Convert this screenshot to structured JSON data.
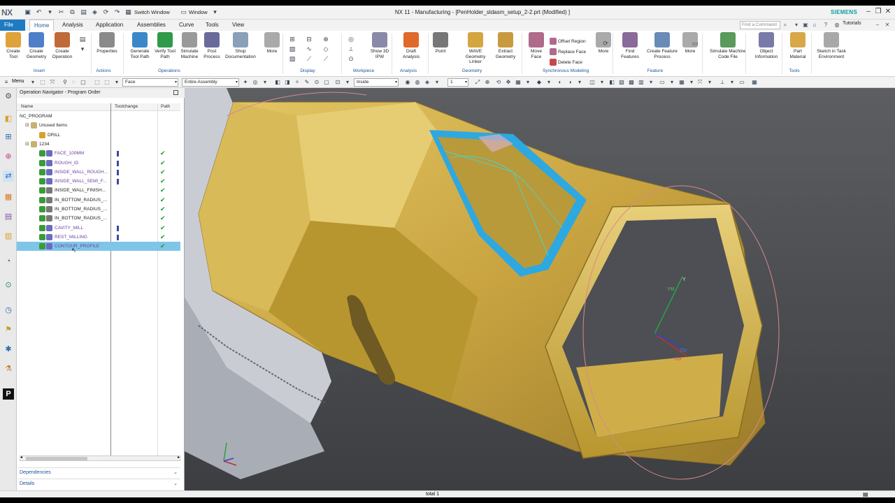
{
  "app": {
    "logo": "NX",
    "title": "NX 11 - Manufacturing - [PenHolder_sldasm_setup_2-2.prt (Modified) ]",
    "brand": "SIEMENS",
    "switch_window": "Switch Window",
    "window_menu": "Window",
    "find_command_placeholder": "Find a Command",
    "tutorials": "Tutorials"
  },
  "tabs": [
    {
      "label": "File"
    },
    {
      "label": "Home"
    },
    {
      "label": "Analysis"
    },
    {
      "label": "Application"
    },
    {
      "label": "Assemblies"
    },
    {
      "label": "Curve"
    },
    {
      "label": "Tools"
    },
    {
      "label": "View"
    }
  ],
  "ribbon": {
    "buttons": [
      {
        "label": "Create Tool",
        "color": "#e0a23a"
      },
      {
        "label": "Create Geometry",
        "color": "#4f7fc8"
      },
      {
        "label": "Create Operation",
        "color": "#c06a3a"
      },
      {
        "label": "Properties",
        "color": "#8a8a8a"
      },
      {
        "label": "Generate Tool Path",
        "color": "#3a88c8"
      },
      {
        "label": "Verify Tool Path",
        "color": "#2f9a4a"
      },
      {
        "label": "Simulate Machine",
        "color": "#9a9a9a"
      },
      {
        "label": "Post Process",
        "color": "#6a6a9a"
      },
      {
        "label": "Shop Documentation",
        "color": "#8aa0b8"
      },
      {
        "label": "More",
        "color": "#aaaaaa"
      },
      {
        "label": "Show 3D IPW",
        "color": "#8a8aa8"
      },
      {
        "label": "Draft Analysis",
        "color": "#e06a2a"
      },
      {
        "label": "Point",
        "color": "#777777"
      },
      {
        "label": "WAVE Geometry Linker",
        "color": "#d4a640"
      },
      {
        "label": "Extract Geometry",
        "color": "#c89a40"
      },
      {
        "label": "Move Face",
        "color": "#b06a8a"
      },
      {
        "label": "More",
        "color": "#aaaaaa"
      },
      {
        "label": "Find Features",
        "color": "#8a6a9a"
      },
      {
        "label": "Create Feature Process",
        "color": "#6a8ab8"
      },
      {
        "label": "More",
        "color": "#aaaaaa"
      },
      {
        "label": "Simulate Machine Code File",
        "color": "#5a9a5a"
      },
      {
        "label": "Object Information",
        "color": "#7a7aa8"
      },
      {
        "label": "Part Material",
        "color": "#d8a848"
      },
      {
        "label": "Sketch in Task Environment",
        "color": "#a8a8a8"
      }
    ],
    "small_items": [
      {
        "label": "Offset Region",
        "color": "#b06a8a"
      },
      {
        "label": "Replace Face",
        "color": "#b06a8a"
      },
      {
        "label": "Delete Face",
        "color": "#c8484a"
      }
    ],
    "groups": [
      {
        "label": "Insert"
      },
      {
        "label": "Actions"
      },
      {
        "label": "Operations"
      },
      {
        "label": "Display"
      },
      {
        "label": "Workpiece"
      },
      {
        "label": "Analysis"
      },
      {
        "label": "Geometry"
      },
      {
        "label": "Synchronous Modeling"
      },
      {
        "label": "Feature"
      },
      {
        "label": "Tools"
      }
    ]
  },
  "selection_bar": {
    "menu": "Menu",
    "filter": "Face",
    "scope": "Entire Assembly",
    "snap": "Inside",
    "layer": "1"
  },
  "navigator": {
    "title": "Operation Navigator - Program Order",
    "columns": {
      "name": "Name",
      "tool_change": "Toolchange",
      "path": "Path"
    },
    "rows": [
      {
        "name": "NC_PROGRAM",
        "indent": 0,
        "kind": "root",
        "tool": false,
        "path": false
      },
      {
        "name": "Unused Items",
        "indent": 1,
        "kind": "group",
        "tool": false,
        "path": false
      },
      {
        "name": "DRILL",
        "indent": 2,
        "kind": "program",
        "tool": false,
        "path": false
      },
      {
        "name": "1234",
        "indent": 1,
        "kind": "group",
        "tool": false,
        "path": false
      },
      {
        "name": "FACE_100MM",
        "indent": 2,
        "kind": "op",
        "tool": true,
        "path": true
      },
      {
        "name": "ROUGH_ID",
        "indent": 2,
        "kind": "op",
        "tool": true,
        "path": true
      },
      {
        "name": "INSIDE_WALL_ROUGH...",
        "indent": 2,
        "kind": "op",
        "tool": true,
        "path": true
      },
      {
        "name": "INSIDE_WALL_SEMI_F...",
        "indent": 2,
        "kind": "op",
        "tool": true,
        "path": true
      },
      {
        "name": "INSIDE_WALL_FINISH...",
        "indent": 2,
        "kind": "opdark",
        "tool": false,
        "path": true
      },
      {
        "name": "IN_BOTTOM_RADIUS_...",
        "indent": 2,
        "kind": "opdark",
        "tool": false,
        "path": true
      },
      {
        "name": "IN_BOTTOM_RADIUS_...",
        "indent": 2,
        "kind": "opdark",
        "tool": false,
        "path": true
      },
      {
        "name": "IN_BOTTOM_RADIUS_...",
        "indent": 2,
        "kind": "opdark",
        "tool": false,
        "path": true
      },
      {
        "name": "CAVITY_MILL",
        "indent": 2,
        "kind": "op",
        "tool": true,
        "path": true
      },
      {
        "name": "REST_MILLING",
        "indent": 2,
        "kind": "op",
        "tool": true,
        "path": true
      },
      {
        "name": "CONTOUR_PROFILE",
        "indent": 2,
        "kind": "op",
        "tool": false,
        "path": true,
        "selected": true
      }
    ],
    "panels": [
      {
        "label": "Dependencies"
      },
      {
        "label": "Details"
      }
    ]
  },
  "viewport": {
    "axis_y": "YM",
    "axis_x": "XM",
    "axis_z": "ZM",
    "axis_y2": "Y"
  },
  "status": {
    "text": "total 1"
  },
  "colors": {
    "file_tab": "#1e7bc2",
    "selection": "#7fc5e8",
    "part": "#d4b04a",
    "highlight": "#2fa6e0",
    "background": "#4c4e52"
  }
}
